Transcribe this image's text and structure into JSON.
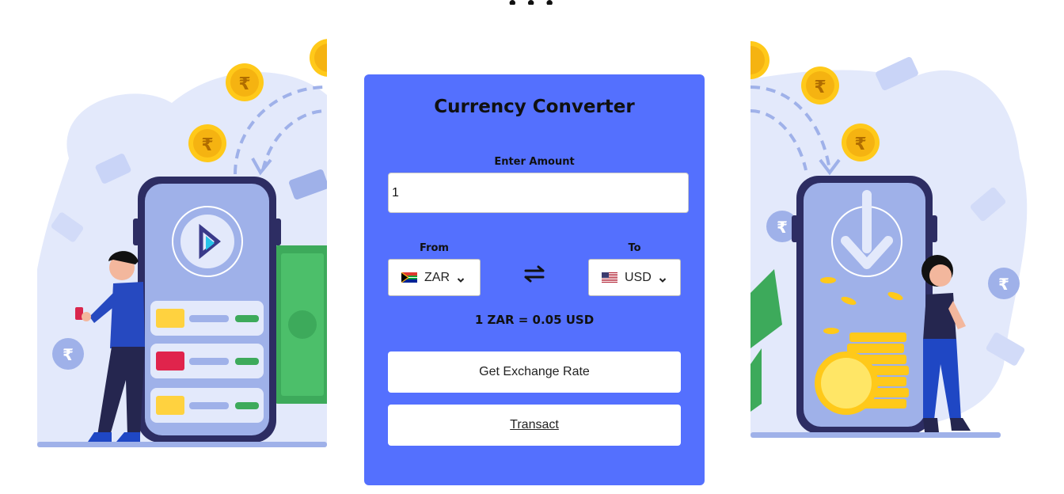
{
  "page": {
    "top_title": "???"
  },
  "converter": {
    "title": "Currency Converter",
    "amount_label": "Enter Amount",
    "amount_value": "1",
    "from_label": "From",
    "to_label": "To",
    "from_currency": "ZAR",
    "to_currency": "USD",
    "rate_text": "1 ZAR = 0.05 USD",
    "get_rate_button": "Get Exchange Rate",
    "transact_link": "Transact"
  },
  "illustrations": {
    "left": {
      "coin_symbol": "₹",
      "bill_symbol": "₹"
    },
    "right": {
      "coin_symbol": "₹",
      "bill_symbol": "₹"
    }
  },
  "colors": {
    "card": "#5470fe",
    "blob": "#e3e9fb",
    "phone": "#9fb1e9",
    "phone_frame": "#2d2d63",
    "coin": "#ffc91a",
    "bill": "#3daa5b"
  }
}
